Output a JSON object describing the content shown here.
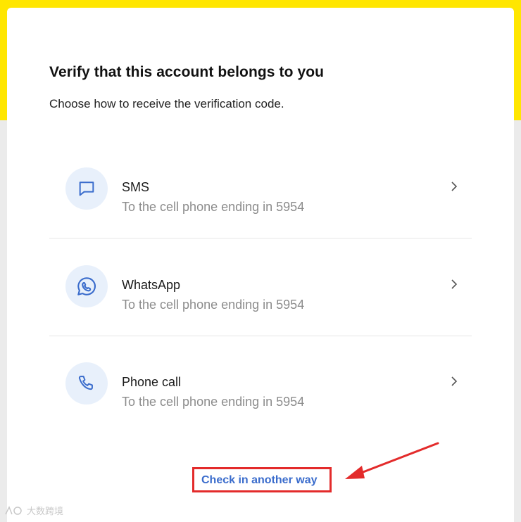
{
  "page": {
    "title": "Verify that this account belongs to you",
    "subtitle": "Choose how to receive the verification code."
  },
  "options": [
    {
      "label": "SMS",
      "description": "To the cell phone ending in 5954",
      "icon": "message-icon"
    },
    {
      "label": "WhatsApp",
      "description": "To the cell phone ending in 5954",
      "icon": "whatsapp-icon"
    },
    {
      "label": "Phone call",
      "description": "To the cell phone ending in 5954",
      "icon": "phone-icon"
    }
  ],
  "footer": {
    "alt_link": "Check in another way"
  },
  "watermark": {
    "text": "大数跨境"
  },
  "colors": {
    "brand_yellow": "#ffe600",
    "icon_blue": "#3a6ccc",
    "icon_bg": "#e8f0fb",
    "link_blue": "#3a6ccc",
    "annotation_red": "#e32b2b"
  }
}
